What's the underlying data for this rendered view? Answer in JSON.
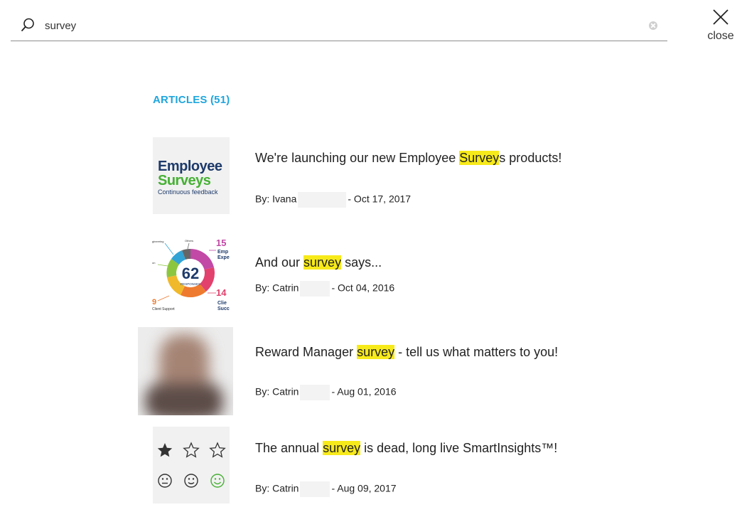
{
  "search": {
    "value": "survey",
    "placeholder": ""
  },
  "close": {
    "label": "close"
  },
  "section": {
    "title": "ARTICLES (51)"
  },
  "thumbs": {
    "employee": {
      "line1": "Employee",
      "line2": "Surveys",
      "line3": "Continuous feedback"
    },
    "donut": {
      "center_value": "62",
      "center_label": "RESPONSES",
      "labels": [
        "gineering",
        "Others",
        "on",
        "15",
        "Emp",
        "Expe",
        "14",
        "Clie",
        "Succ",
        "9",
        "Client Support"
      ]
    }
  },
  "articles": [
    {
      "title_pre": "We're launching our new Employee ",
      "title_hl": "Survey",
      "title_post": "s products!",
      "author": "By: Ivana",
      "date": "- Oct 17, 2017"
    },
    {
      "title_pre": "And our ",
      "title_hl": "survey",
      "title_post": " says...",
      "author": "By: Catrin",
      "date": "- Oct 04, 2016"
    },
    {
      "title_pre": "Reward Manager ",
      "title_hl": "survey",
      "title_post": " - tell us what matters to you!",
      "author": "By: Catrin",
      "date": "- Aug 01, 2016"
    },
    {
      "title_pre": "The annual ",
      "title_hl": "survey",
      "title_post": " is dead, long live SmartInsights™!",
      "author": "By: Catrin",
      "date": "- Aug 09, 2017"
    }
  ],
  "colors": {
    "accent": "#1ea6de",
    "highlight": "#f7ea1a",
    "brand_navy": "#1d3a6a",
    "brand_green": "#46b034"
  }
}
